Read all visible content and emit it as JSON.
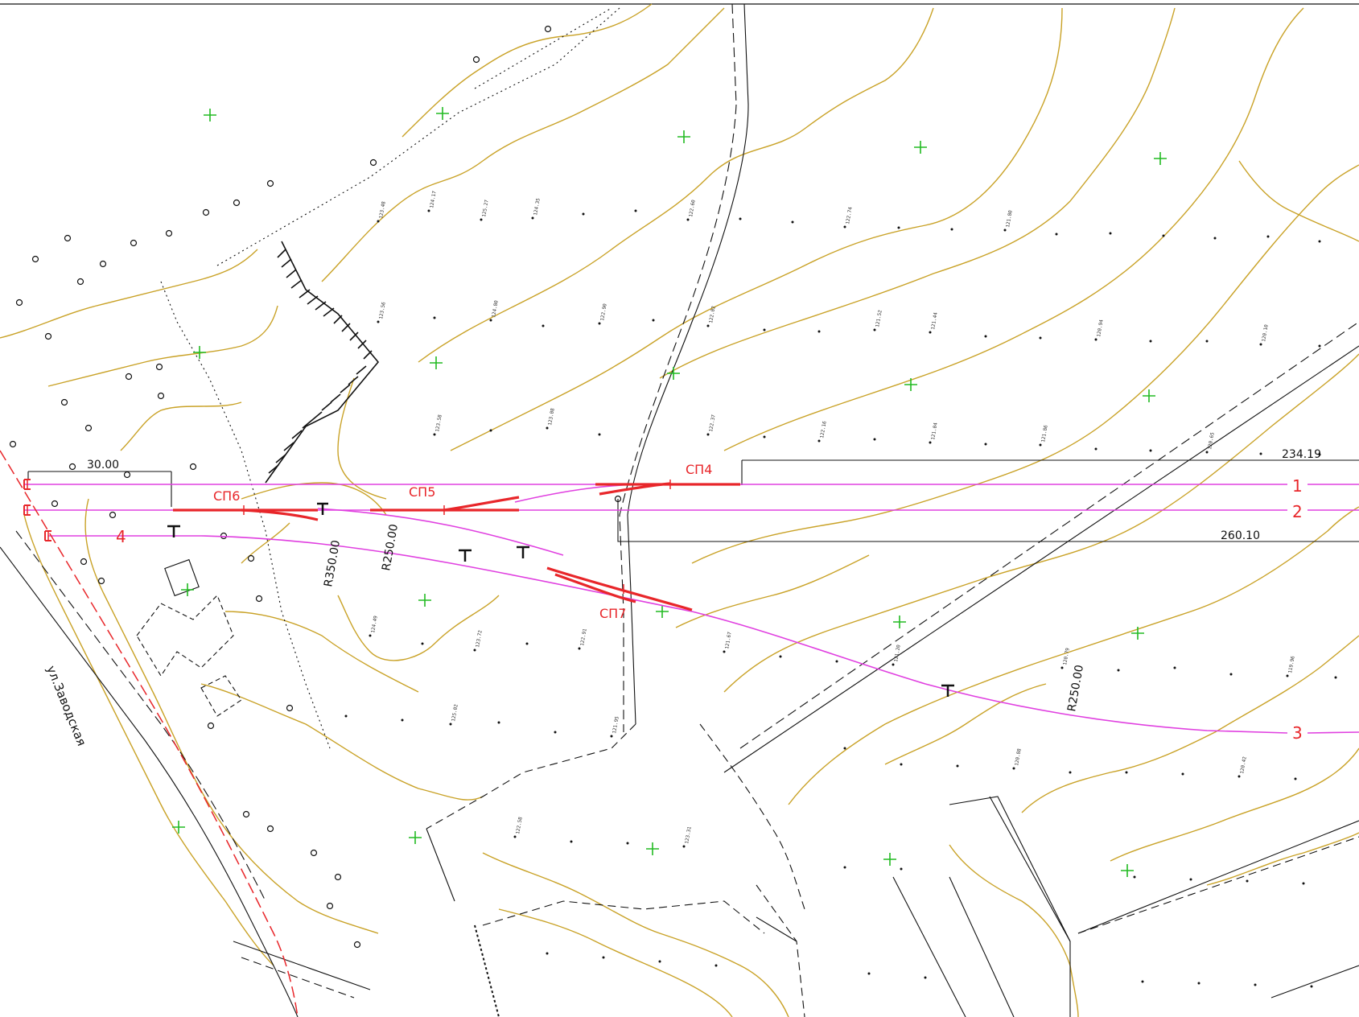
{
  "map": {
    "colors": {
      "contour": "#c9a227",
      "track_alignment": "#e040e0",
      "switch": "#e8262a",
      "vegetation": "#22bb22",
      "linework": "#111111"
    },
    "track_numbers": [
      "1",
      "2",
      "3",
      "4"
    ],
    "switch_labels": [
      "СП4",
      "СП5",
      "СП6",
      "СП7"
    ],
    "dimensions": [
      "30.00",
      "234.19",
      "260.10"
    ],
    "curve_radii": [
      "R350.00",
      "R250.00",
      "R250.00"
    ],
    "street_name": "ул.Заводская",
    "sample_elevations": [
      "123.48",
      "124.17",
      "125.27",
      "122.60",
      "124.35",
      "122.74",
      "121.80",
      "123.56",
      "122.02",
      "121.52",
      "120.94",
      "121.44",
      "120.10",
      "122.90",
      "124.80",
      "123.58",
      "122.37",
      "121.04",
      "123.08",
      "122.16",
      "121.86",
      "120.65",
      "121.20",
      "119.96",
      "120.79",
      "121.67",
      "122.91",
      "123.72",
      "124.49",
      "125.02",
      "120.42",
      "121.95",
      "122.58",
      "123.31",
      "120.88"
    ]
  }
}
